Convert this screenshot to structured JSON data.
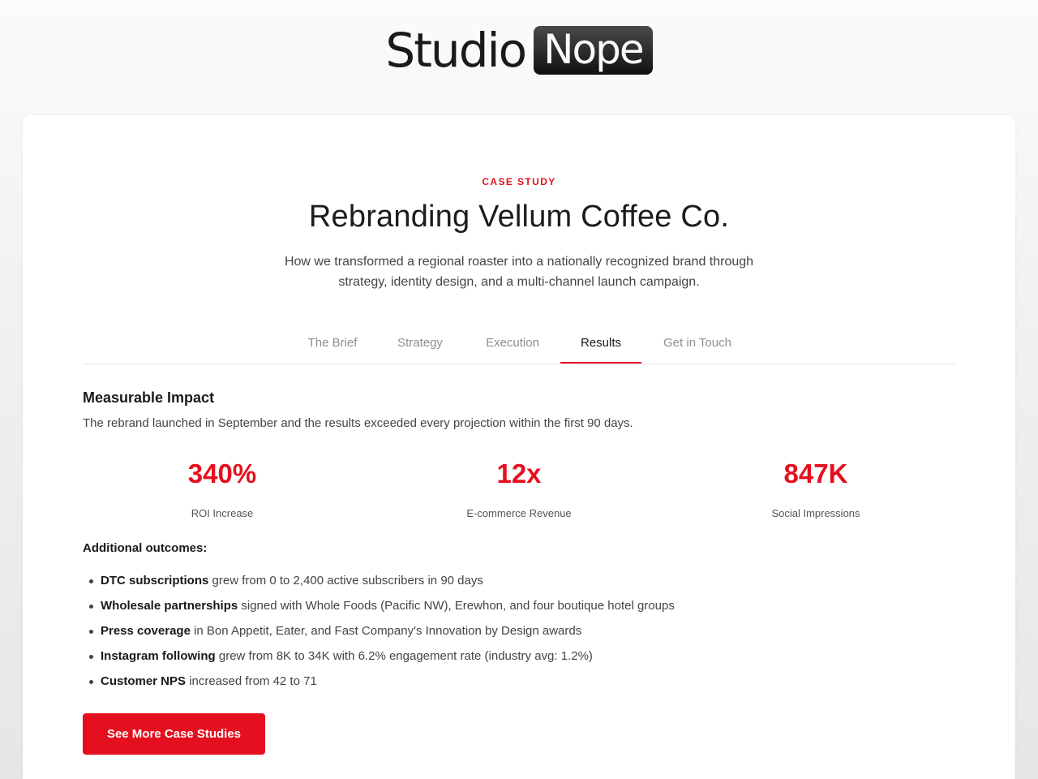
{
  "brand": {
    "logo_word_1": "Studio",
    "logo_word_2": "Nope"
  },
  "hero": {
    "eyebrow": "CASE STUDY",
    "title": "Rebranding Vellum Coffee Co.",
    "subtitle": "How we transformed a regional roaster into a nationally recognized brand through strategy, identity design, and a multi-channel launch campaign."
  },
  "tabs": [
    {
      "label": "The Brief",
      "active": false
    },
    {
      "label": "Strategy",
      "active": false
    },
    {
      "label": "Execution",
      "active": false
    },
    {
      "label": "Results",
      "active": true
    },
    {
      "label": "Get in Touch",
      "active": false
    }
  ],
  "results": {
    "heading": "Measurable Impact",
    "description": "The rebrand launched in September and the results exceeded every projection within the first 90 days.",
    "stats": [
      {
        "value": "340%",
        "label": "ROI Increase"
      },
      {
        "value": "12x",
        "label": "E-commerce Revenue"
      },
      {
        "value": "847K",
        "label": "Social Impressions"
      }
    ],
    "outcomes_heading": "Additional outcomes:",
    "outcomes": [
      {
        "bold": "DTC subscriptions",
        "text": " grew from 0 to 2,400 active subscribers in 90 days"
      },
      {
        "bold": "Wholesale partnerships",
        "text": " signed with Whole Foods (Pacific NW), Erewhon, and four boutique hotel groups"
      },
      {
        "bold": "Press coverage",
        "text": " in Bon Appetit, Eater, and Fast Company's Innovation by Design awards"
      },
      {
        "bold": "Instagram following",
        "text": " grew from 8K to 34K with 6.2% engagement rate (industry avg: 1.2%)"
      },
      {
        "bold": "Customer NPS",
        "text": " increased from 42 to 71"
      }
    ],
    "cta_label": "See More Case Studies"
  },
  "colors": {
    "accent": "#e5101f",
    "text": "#1a1a1a",
    "muted": "#8e8e8e"
  }
}
